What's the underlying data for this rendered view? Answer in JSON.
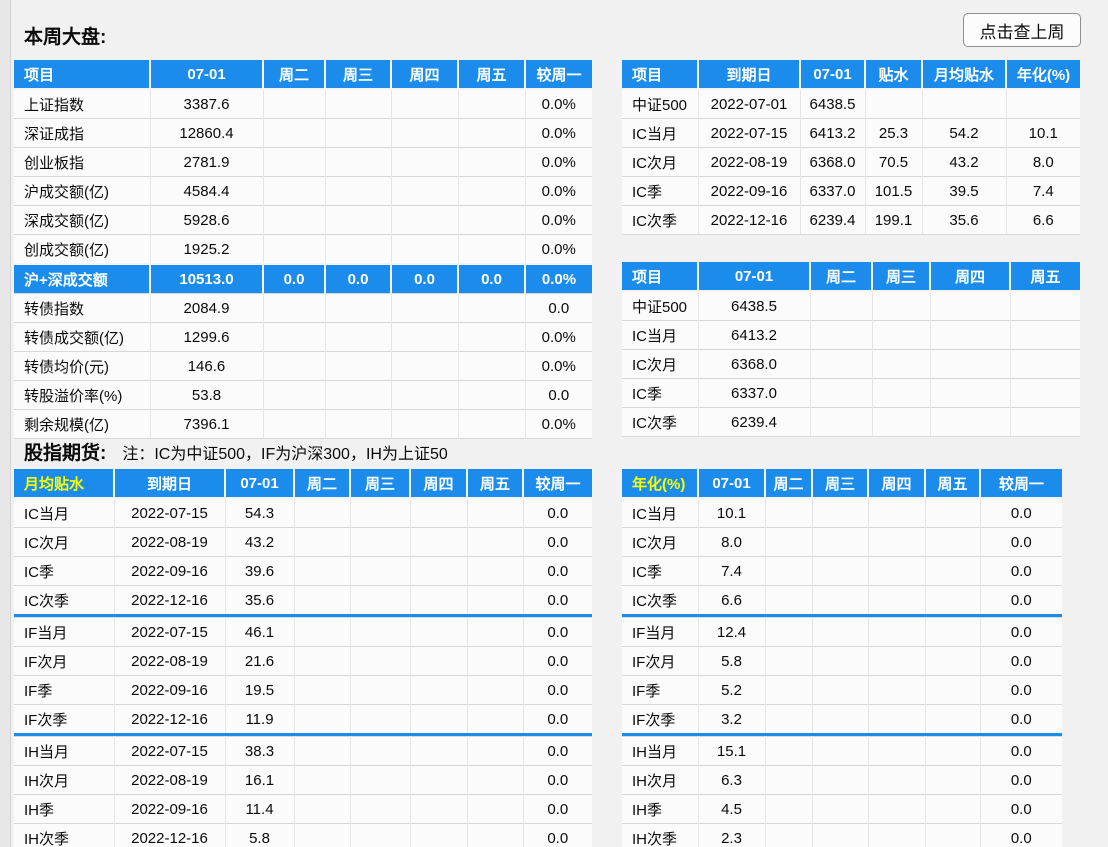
{
  "page": {
    "title": "本周大盘:",
    "lastweek_button": "点击查上周",
    "section2_title": "股指期货:",
    "section2_note": "注：IC为中证500，IF为沪深300，IH为上证50"
  },
  "colors": {
    "header_blue": "#1b8ceb",
    "header_yellow": "#f8ff00"
  },
  "tables": {
    "market": {
      "headers": [
        "项目",
        "07-01",
        "周二",
        "周三",
        "周四",
        "周五",
        "较周一"
      ],
      "rows": [
        {
          "cells": [
            "上证指数",
            "3387.6",
            "",
            "",
            "",
            "",
            "0.0%"
          ]
        },
        {
          "cells": [
            "深证成指",
            "12860.4",
            "",
            "",
            "",
            "",
            "0.0%"
          ]
        },
        {
          "cells": [
            "创业板指",
            "2781.9",
            "",
            "",
            "",
            "",
            "0.0%"
          ]
        },
        {
          "cells": [
            "沪成交额(亿)",
            "4584.4",
            "",
            "",
            "",
            "",
            "0.0%"
          ]
        },
        {
          "cells": [
            "深成交额(亿)",
            "5928.6",
            "",
            "",
            "",
            "",
            "0.0%"
          ]
        },
        {
          "cells": [
            "创成交额(亿)",
            "1925.2",
            "",
            "",
            "",
            "",
            "0.0%"
          ]
        },
        {
          "cells": [
            "沪+深成交额",
            "10513.0",
            "0.0",
            "0.0",
            "0.0",
            "0.0",
            "0.0%"
          ],
          "highlight": true
        },
        {
          "cells": [
            "转债指数",
            "2084.9",
            "",
            "",
            "",
            "",
            "0.0"
          ]
        },
        {
          "cells": [
            "转债成交额(亿)",
            "1299.6",
            "",
            "",
            "",
            "",
            "0.0%"
          ]
        },
        {
          "cells": [
            "转债均价(元)",
            "146.6",
            "",
            "",
            "",
            "",
            "0.0%"
          ]
        },
        {
          "cells": [
            "转股溢价率(%)",
            "53.8",
            "",
            "",
            "",
            "",
            "0.0"
          ]
        },
        {
          "cells": [
            "剩余规模(亿)",
            "7396.1",
            "",
            "",
            "",
            "",
            "0.0%"
          ]
        }
      ]
    },
    "ic_detail": {
      "headers": [
        "项目",
        "到期日",
        "07-01",
        "贴水",
        "月均贴水",
        "年化(%)"
      ],
      "rows": [
        {
          "cells": [
            "中证500",
            "2022-07-01",
            "6438.5",
            "",
            "",
            ""
          ]
        },
        {
          "cells": [
            "IC当月",
            "2022-07-15",
            "6413.2",
            "25.3",
            "54.2",
            "10.1"
          ]
        },
        {
          "cells": [
            "IC次月",
            "2022-08-19",
            "6368.0",
            "70.5",
            "43.2",
            "8.0"
          ]
        },
        {
          "cells": [
            "IC季",
            "2022-09-16",
            "6337.0",
            "101.5",
            "39.5",
            "7.4"
          ]
        },
        {
          "cells": [
            "IC次季",
            "2022-12-16",
            "6239.4",
            "199.1",
            "35.6",
            "6.6"
          ]
        }
      ]
    },
    "ic_week": {
      "headers": [
        "项目",
        "07-01",
        "周二",
        "周三",
        "周四",
        "周五"
      ],
      "rows": [
        {
          "cells": [
            "中证500",
            "6438.5",
            "",
            "",
            "",
            ""
          ]
        },
        {
          "cells": [
            "IC当月",
            "6413.2",
            "",
            "",
            "",
            ""
          ]
        },
        {
          "cells": [
            "IC次月",
            "6368.0",
            "",
            "",
            "",
            ""
          ]
        },
        {
          "cells": [
            "IC季",
            "6337.0",
            "",
            "",
            "",
            ""
          ]
        },
        {
          "cells": [
            "IC次季",
            "6239.4",
            "",
            "",
            "",
            ""
          ]
        }
      ]
    },
    "monthly": {
      "accent_first_header": true,
      "headers": [
        "月均贴水",
        "到期日",
        "07-01",
        "周二",
        "周三",
        "周四",
        "周五",
        "较周一"
      ],
      "rows": [
        {
          "cells": [
            "IC当月",
            "2022-07-15",
            "54.3",
            "",
            "",
            "",
            "",
            "0.0"
          ]
        },
        {
          "cells": [
            "IC次月",
            "2022-08-19",
            "43.2",
            "",
            "",
            "",
            "",
            "0.0"
          ]
        },
        {
          "cells": [
            "IC季",
            "2022-09-16",
            "39.6",
            "",
            "",
            "",
            "",
            "0.0"
          ]
        },
        {
          "cells": [
            "IC次季",
            "2022-12-16",
            "35.6",
            "",
            "",
            "",
            "",
            "0.0"
          ],
          "separator_after": true
        },
        {
          "cells": [
            "IF当月",
            "2022-07-15",
            "46.1",
            "",
            "",
            "",
            "",
            "0.0"
          ]
        },
        {
          "cells": [
            "IF次月",
            "2022-08-19",
            "21.6",
            "",
            "",
            "",
            "",
            "0.0"
          ]
        },
        {
          "cells": [
            "IF季",
            "2022-09-16",
            "19.5",
            "",
            "",
            "",
            "",
            "0.0"
          ]
        },
        {
          "cells": [
            "IF次季",
            "2022-12-16",
            "11.9",
            "",
            "",
            "",
            "",
            "0.0"
          ],
          "separator_after": true
        },
        {
          "cells": [
            "IH当月",
            "2022-07-15",
            "38.3",
            "",
            "",
            "",
            "",
            "0.0"
          ]
        },
        {
          "cells": [
            "IH次月",
            "2022-08-19",
            "16.1",
            "",
            "",
            "",
            "",
            "0.0"
          ]
        },
        {
          "cells": [
            "IH季",
            "2022-09-16",
            "11.4",
            "",
            "",
            "",
            "",
            "0.0"
          ]
        },
        {
          "cells": [
            "IH次季",
            "2022-12-16",
            "5.8",
            "",
            "",
            "",
            "",
            "0.0"
          ]
        }
      ]
    },
    "annual": {
      "accent_first_header": true,
      "headers": [
        "年化(%)",
        "07-01",
        "周二",
        "周三",
        "周四",
        "周五",
        "较周一"
      ],
      "rows": [
        {
          "cells": [
            "IC当月",
            "10.1",
            "",
            "",
            "",
            "",
            "0.0"
          ]
        },
        {
          "cells": [
            "IC次月",
            "8.0",
            "",
            "",
            "",
            "",
            "0.0"
          ]
        },
        {
          "cells": [
            "IC季",
            "7.4",
            "",
            "",
            "",
            "",
            "0.0"
          ]
        },
        {
          "cells": [
            "IC次季",
            "6.6",
            "",
            "",
            "",
            "",
            "0.0"
          ],
          "separator_after": true
        },
        {
          "cells": [
            "IF当月",
            "12.4",
            "",
            "",
            "",
            "",
            "0.0"
          ]
        },
        {
          "cells": [
            "IF次月",
            "5.8",
            "",
            "",
            "",
            "",
            "0.0"
          ]
        },
        {
          "cells": [
            "IF季",
            "5.2",
            "",
            "",
            "",
            "",
            "0.0"
          ]
        },
        {
          "cells": [
            "IF次季",
            "3.2",
            "",
            "",
            "",
            "",
            "0.0"
          ],
          "separator_after": true
        },
        {
          "cells": [
            "IH当月",
            "15.1",
            "",
            "",
            "",
            "",
            "0.0"
          ]
        },
        {
          "cells": [
            "IH次月",
            "6.3",
            "",
            "",
            "",
            "",
            "0.0"
          ]
        },
        {
          "cells": [
            "IH季",
            "4.5",
            "",
            "",
            "",
            "",
            "0.0"
          ]
        },
        {
          "cells": [
            "IH次季",
            "2.3",
            "",
            "",
            "",
            "",
            "0.0"
          ]
        }
      ]
    }
  }
}
